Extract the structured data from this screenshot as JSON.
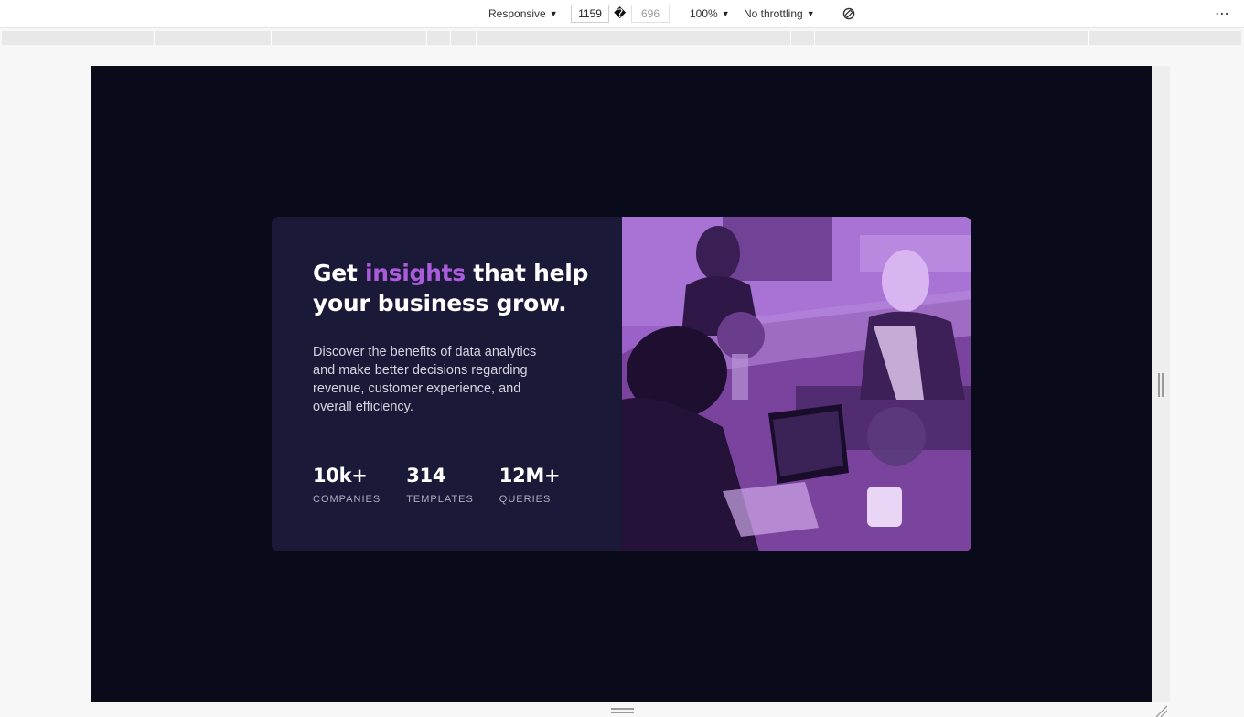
{
  "devtools": {
    "device_mode": "Responsive",
    "width_value": "1159",
    "height_value": "696",
    "zoom": "100%",
    "throttling": "No throttling",
    "dimension_separator": "�"
  },
  "card": {
    "headline_before": "Get ",
    "headline_accent": "insights",
    "headline_after": " that help your business grow.",
    "description": "Discover the benefits of data analytics and make better decisions regarding revenue, customer experience, and overall efficiency.",
    "stats": [
      {
        "value": "10k+",
        "label": "COMPANIES"
      },
      {
        "value": "314",
        "label": "TEMPLATES"
      },
      {
        "value": "12M+",
        "label": "QUERIES"
      }
    ],
    "image_alt": "Team working together at an office table with a laptop"
  },
  "colors": {
    "page_bg": "#090b1b",
    "card_bg": "#1b1938",
    "accent": "#aa5cdb",
    "image_overlay": "#8e55b9"
  }
}
